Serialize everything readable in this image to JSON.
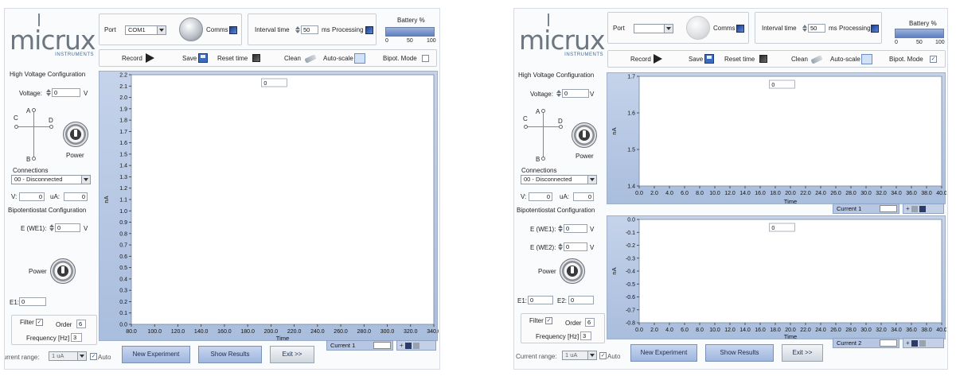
{
  "window1": {
    "logo": {
      "word": "micrux",
      "sub": "INSTRUMENTS"
    },
    "top": {
      "port_label": "Port",
      "port_value": "COM1",
      "comms_label": "Comms",
      "interval_label": "Interval time",
      "interval_value": "50",
      "interval_unit": "ms",
      "processing_label": "Processing",
      "battery_label": "Battery %",
      "battery_ticks": [
        "0",
        "50",
        "100"
      ],
      "record_label": "Record",
      "save_label": "Save",
      "reset_label": "Reset time",
      "clean_label": "Clean",
      "autoscale_label": "Auto-scale",
      "bipot_label": "Bipot. Mode"
    },
    "hv": {
      "section_title": "High Voltage Configuration",
      "voltage_label": "Voltage:",
      "voltage_value": "0",
      "voltage_unit": "V",
      "electrodes": [
        "A",
        "B",
        "C",
        "D"
      ],
      "power_label": "Power",
      "connections_label": "Connections",
      "connections_value": "00 - Disconnected",
      "v_label": "V:",
      "v_value": "0",
      "ua_label": "uA:",
      "ua_value": "0"
    },
    "bipot": {
      "section_title": "Bipotentiostat Configuration",
      "e_label": "E (WE1):",
      "e_value": "0",
      "e_unit": "V",
      "power_label": "Power",
      "e1_label": "E1:",
      "e1_value": "0",
      "filter_label": "Filter",
      "order_label": "Order",
      "order_value": "6",
      "freq_label": "Frequency [Hz]",
      "freq_value": "3"
    },
    "bottom": {
      "range_label": "Current range:",
      "range_value": "1 uA",
      "auto_label": "Auto",
      "new_label": "New Experiment",
      "results_label": "Show Results",
      "exit_label": "Exit >>",
      "legend_label": "Current 1"
    }
  },
  "window2": {
    "logo": {
      "word": "micrux",
      "sub": "INSTRUMENTS"
    },
    "top": {
      "port_label": "Port",
      "port_value": "",
      "comms_label": "Comms",
      "interval_label": "Interval time",
      "interval_value": "50",
      "interval_unit": "ms",
      "processing_label": "Processing",
      "battery_label": "Battery %",
      "battery_ticks": [
        "0",
        "50",
        "100"
      ],
      "record_label": "Record",
      "save_label": "Save",
      "reset_label": "Reset time",
      "clean_label": "Clean",
      "autoscale_label": "Auto-scale",
      "bipot_label": "Bipot. Mode"
    },
    "hv": {
      "section_title": "High Voltage Configuration",
      "voltage_label": "Voltage:",
      "voltage_value": "0",
      "voltage_unit": "V",
      "electrodes": [
        "A",
        "B",
        "C",
        "D"
      ],
      "power_label": "Power",
      "connections_label": "Connections",
      "connections_value": "00 - Disconnected",
      "v_label": "V:",
      "v_value": "0",
      "ua_label": "uA:",
      "ua_value": "0"
    },
    "bipot": {
      "section_title": "Bipotentiostat Configuration",
      "e1_field_label": "E (WE1):",
      "e1_field_value": "0",
      "e1_field_unit": "V",
      "e2_field_label": "E (WE2):",
      "e2_field_value": "0",
      "e2_field_unit": "V",
      "power_label": "Power",
      "e1_label": "E1:",
      "e1_value": "0",
      "e2_label": "E2:",
      "e2_value": "0",
      "filter_label": "Filter",
      "order_label": "Order",
      "order_value": "6",
      "freq_label": "Frequency [Hz]",
      "freq_value": "3"
    },
    "bottom": {
      "range_label": "Current range:",
      "range_value": "1 uA",
      "auto_label": "Auto",
      "new_label": "New Experiment",
      "results_label": "Show Results",
      "exit_label": "Exit >>",
      "legend1_label": "Current 1",
      "legend2_label": "Current 2"
    }
  },
  "colors": {
    "accent": "#5b86d6",
    "plot_frame": "#b3c5e3",
    "plot_bg": "#ffffff"
  },
  "chart_data": [
    {
      "type": "line",
      "id": "w1_current1",
      "xlabel": "Time",
      "ylabel": "nA",
      "xlim": [
        80,
        340
      ],
      "ylim": [
        0.0,
        2.2
      ],
      "x_ticks": [
        "80.0",
        "100.0",
        "120.0",
        "140.0",
        "160.0",
        "180.0",
        "200.0",
        "220.0",
        "240.0",
        "260.0",
        "280.0",
        "300.0",
        "320.0",
        "340.0"
      ],
      "y_ticks": [
        "0.0",
        "0.1",
        "0.2",
        "0.3",
        "0.4",
        "0.5",
        "0.6",
        "0.7",
        "0.8",
        "0.9",
        "1.0",
        "1.1",
        "1.2",
        "1.3",
        "1.4",
        "1.5",
        "1.6",
        "1.7",
        "1.8",
        "1.9",
        "2.0",
        "2.1",
        "2.2"
      ],
      "readout": "0",
      "series": []
    },
    {
      "type": "line",
      "id": "w2_current1",
      "xlabel": "Time",
      "ylabel": "nA",
      "xlim": [
        0,
        40
      ],
      "ylim": [
        1.4,
        1.7
      ],
      "x_ticks": [
        "0.0",
        "2.0",
        "4.0",
        "6.0",
        "8.0",
        "10.0",
        "12.0",
        "14.0",
        "16.0",
        "18.0",
        "20.0",
        "22.0",
        "24.0",
        "26.0",
        "28.0",
        "30.0",
        "32.0",
        "34.0",
        "36.0",
        "38.0",
        "40.0"
      ],
      "y_ticks": [
        "1.4",
        "1.5",
        "1.6",
        "1.7"
      ],
      "readout": "0",
      "series": []
    },
    {
      "type": "line",
      "id": "w2_current2",
      "xlabel": "Time",
      "ylabel": "nA",
      "xlim": [
        0,
        40
      ],
      "ylim": [
        -0.8,
        0.0
      ],
      "x_ticks": [
        "0.0",
        "2.0",
        "4.0",
        "6.0",
        "8.0",
        "10.0",
        "12.0",
        "14.0",
        "16.0",
        "18.0",
        "20.0",
        "22.0",
        "24.0",
        "26.0",
        "28.0",
        "30.0",
        "32.0",
        "34.0",
        "36.0",
        "38.0",
        "40.0"
      ],
      "y_ticks": [
        "-0.8",
        "-0.7",
        "-0.6",
        "-0.5",
        "-0.4",
        "-0.3",
        "-0.2",
        "-0.1",
        "0.0"
      ],
      "readout": "0",
      "series": []
    }
  ]
}
